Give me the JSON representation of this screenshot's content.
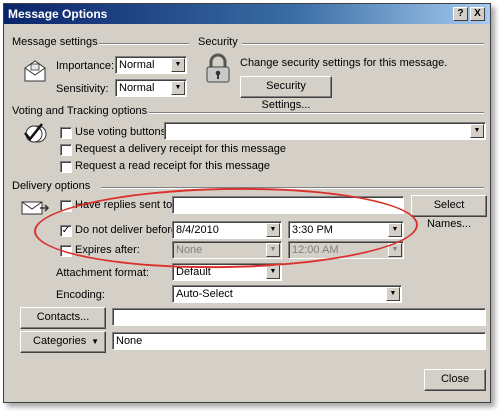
{
  "window": {
    "title": "Message Options",
    "help_glyph": "?",
    "close_glyph": "X"
  },
  "message_settings": {
    "section_title": "Message settings",
    "importance_label": "Importance:",
    "importance_value": "Normal",
    "sensitivity_label": "Sensitivity:",
    "sensitivity_value": "Normal",
    "icon": "envelope-icon"
  },
  "security": {
    "section_title": "Security",
    "description": "Change security settings for this message.",
    "button_label": "Security Settings...",
    "icon": "padlock-icon"
  },
  "voting_tracking": {
    "section_title": "Voting and Tracking options",
    "use_voting_label": "Use voting buttons:",
    "voting_value": "",
    "delivery_receipt_label": "Request a delivery receipt for this message",
    "read_receipt_label": "Request a read receipt for this message",
    "icon": "voting-icon"
  },
  "delivery": {
    "section_title": "Delivery options",
    "have_replies_label": "Have replies sent to:",
    "have_replies_value": "",
    "select_names_label": "Select Names...",
    "do_not_deliver_label": "Do not deliver before:",
    "do_not_deliver_checked": true,
    "deliver_date": "8/4/2010",
    "deliver_time": "3:30 PM",
    "expires_label": "Expires after:",
    "expires_checked": false,
    "expires_date": "None",
    "expires_time": "12:00 AM",
    "attachment_format_label": "Attachment format:",
    "attachment_format_value": "Default",
    "encoding_label": "Encoding:",
    "encoding_value": "Auto-Select",
    "icon": "delivery-icon"
  },
  "contacts": {
    "button_label": "Contacts...",
    "value": ""
  },
  "categories": {
    "button_label": "Categories",
    "value": "None"
  },
  "footer": {
    "close_label": "Close"
  },
  "colors": {
    "dialog_bg": "#d4d0c8",
    "title_bar": "#0a246a",
    "highlight": "#d9322c"
  }
}
